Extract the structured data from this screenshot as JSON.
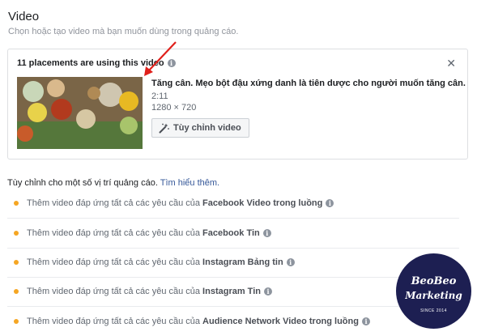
{
  "section": {
    "title": "Video",
    "subtitle": "Chọn hoặc tạo video mà bạn muốn dùng trong quảng cáo."
  },
  "card": {
    "heading": "11 placements are using this video",
    "video_title": "Tăng cân. Mẹo bột đậu xứng danh là tiên dược cho người muốn tăng cân.",
    "duration": "2:11",
    "resolution": "1280 × 720",
    "customize_label": "Tùy chỉnh video",
    "close_icon": "close-icon",
    "info_icon": "info-icon"
  },
  "customize": {
    "text": "Tùy chỉnh cho một số vị trí quảng cáo.",
    "learn_more": "Tìm hiểu thêm."
  },
  "requirements": [
    {
      "prefix": "Thêm video đáp ứng tất cả các yêu cầu của",
      "placement": "Facebook Video trong luồng"
    },
    {
      "prefix": "Thêm video đáp ứng tất cả các yêu cầu của",
      "placement": "Facebook Tin"
    },
    {
      "prefix": "Thêm video đáp ứng tất cả các yêu cầu của",
      "placement": "Instagram Bảng tin"
    },
    {
      "prefix": "Thêm video đáp ứng tất cả các yêu cầu của",
      "placement": "Instagram Tin"
    },
    {
      "prefix": "Thêm video đáp ứng tất cả các yêu cầu của",
      "placement": "Audience Network Video trong luồng"
    }
  ],
  "watermark": {
    "line1": "BeoBeo",
    "line2": "Marketing",
    "line3": "SINCE 2014"
  },
  "colors": {
    "status_dot": "#f5a623",
    "link": "#365899",
    "annotation_arrow": "#e0201b",
    "watermark_bg": "#1d1f52"
  }
}
